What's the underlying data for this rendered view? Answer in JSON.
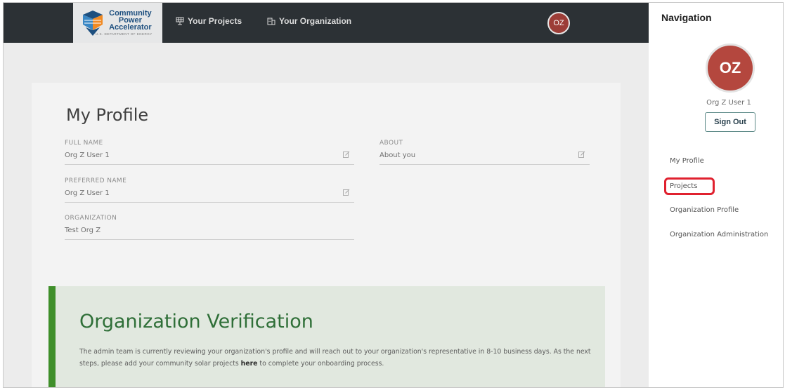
{
  "header": {
    "logo_lines": [
      "Community",
      "Power",
      "Accelerator"
    ],
    "logo_sub": "U.S. DEPARTMENT OF ENERGY",
    "nav_projects": "Your Projects",
    "nav_organization": "Your Organization",
    "avatar_initials": "OZ"
  },
  "profile": {
    "title": "My Profile",
    "fields": {
      "full_name": {
        "label": "FULL NAME",
        "value": "Org Z User 1"
      },
      "preferred_name": {
        "label": "PREFERRED NAME",
        "value": "Org Z User 1"
      },
      "organization": {
        "label": "ORGANIZATION",
        "value": "Test Org Z"
      },
      "about": {
        "label": "ABOUT",
        "value": "About you"
      }
    }
  },
  "verification": {
    "title": "Organization Verification",
    "text_before": "The admin team is currently reviewing your organization's profile and will reach out to your organization's representative in 8-10 business days. As the next steps, please add your community solar projects ",
    "link": "here",
    "text_after": " to complete your onboarding process."
  },
  "drawer": {
    "title": "Navigation",
    "avatar_initials": "OZ",
    "user_name": "Org Z User 1",
    "sign_out": "Sign Out",
    "items": [
      "My Profile",
      "Projects",
      "Organization Profile",
      "Organization Administration"
    ]
  },
  "colors": {
    "topbar": "#2c3135",
    "avatar": "#b4473e",
    "verify_green": "#3f8f2a",
    "highlight": "#e0212f"
  }
}
